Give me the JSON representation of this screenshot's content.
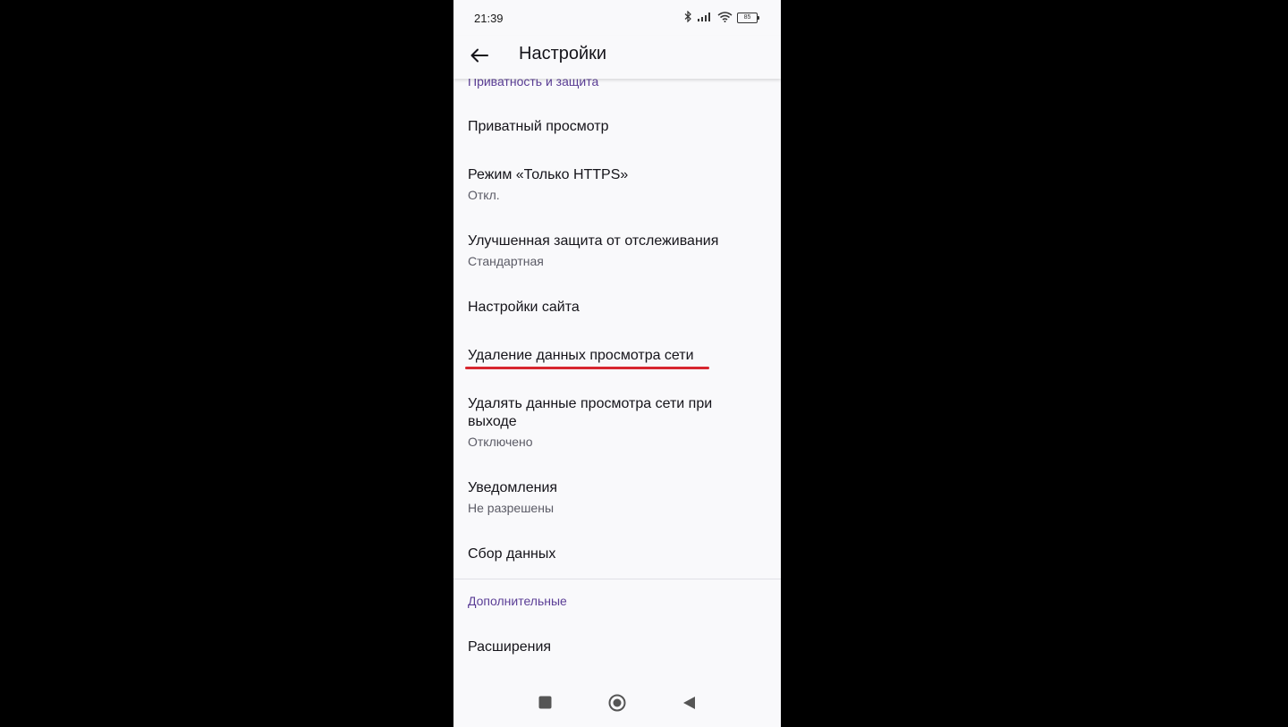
{
  "status_bar": {
    "time": "21:39",
    "battery_level": "85",
    "icons": [
      "bluetooth-icon",
      "signal-icon",
      "wifi-icon",
      "battery-icon"
    ]
  },
  "app_bar": {
    "title": "Настройки",
    "back_icon": "arrow-left-icon"
  },
  "sections": {
    "privacy_header": "Приватность и защита",
    "advanced_header": "Дополнительные"
  },
  "settings": [
    {
      "title": "Приватный просмотр",
      "summary": ""
    },
    {
      "title": "Режим «Только HTTPS»",
      "summary": "Откл."
    },
    {
      "title": "Улучшенная защита от отслеживания",
      "summary": "Стандартная"
    },
    {
      "title": "Настройки сайта",
      "summary": ""
    },
    {
      "title": "Удаление данных просмотра сети",
      "summary": ""
    },
    {
      "title": "Удалять данные просмотра сети при выходе",
      "summary": "Отключено"
    },
    {
      "title": "Уведомления",
      "summary": "Не разрешены"
    },
    {
      "title": "Сбор данных",
      "summary": ""
    },
    {
      "title": "Расширения",
      "summary": ""
    }
  ],
  "nav_bar": {
    "icons": [
      "recents-square-icon",
      "home-circle-icon",
      "back-triangle-icon"
    ]
  },
  "colors": {
    "accent": "#5b3e96",
    "highlight_underline": "#d7262f",
    "background": "#f9f9fb"
  }
}
